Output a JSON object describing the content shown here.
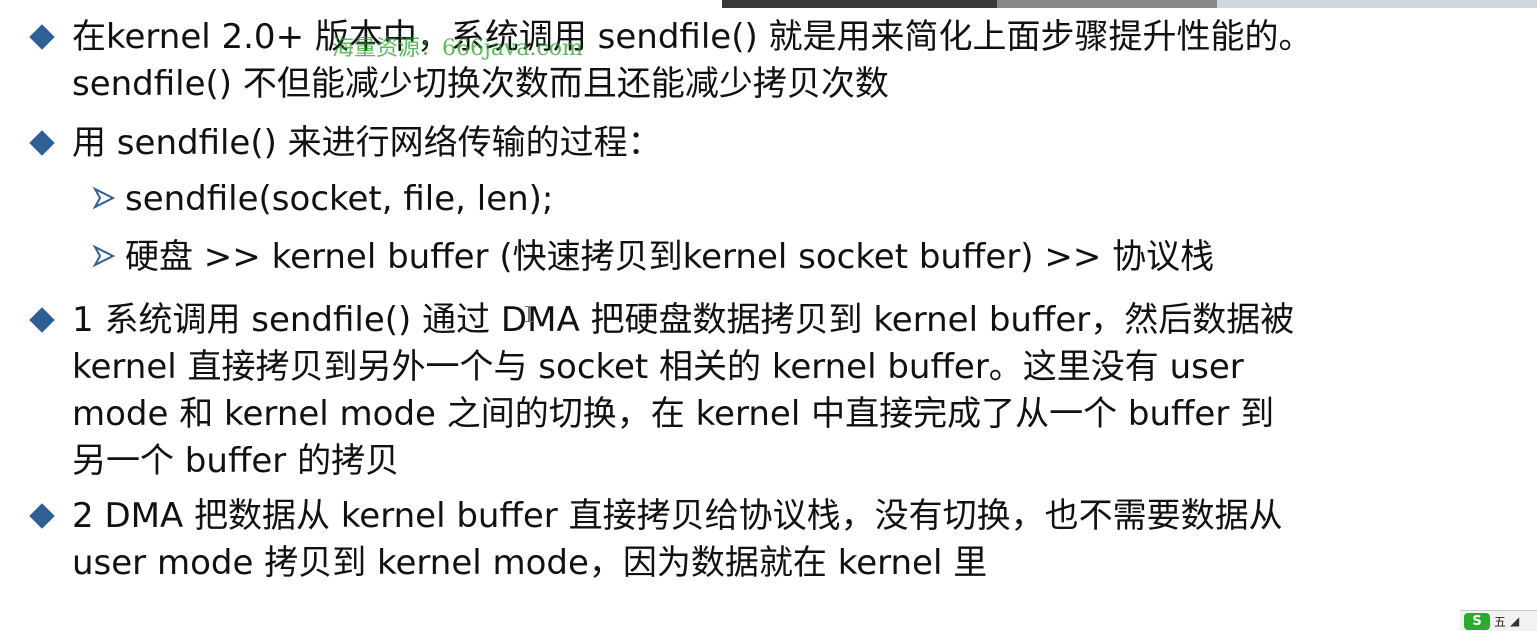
{
  "slide": {
    "bullet1": {
      "line1": "在kernel 2.0+ 版本中，系统调用 sendfile() 就是用来简化上面步骤提升性能的。",
      "line2": "sendfile() 不但能减少切换次数而且还能减少拷贝次数"
    },
    "bullet2": {
      "text": "用 sendfile() 来进行网络传输的过程：",
      "sub1": "sendfile(socket, file, len);",
      "sub2": "硬盘 >> kernel buffer (快速拷贝到kernel socket buffer) >> 协议栈"
    },
    "bullet3": {
      "line1": "1 系统调用 sendfile() 通过 DMA 把硬盘数据拷贝到 kernel buffer，然后数据被",
      "line2": "kernel 直接拷贝到另外一个与 socket 相关的 kernel buffer。这里没有 user",
      "line3": "mode 和 kernel mode 之间的切换，在 kernel 中直接完成了从一个 buffer 到",
      "line4": "另一个 buffer 的拷贝"
    },
    "bullet4": {
      "line1": "2 DMA 把数据从 kernel buffer 直接拷贝给协议栈，没有切换，也不需要数据从",
      "line2": "user mode 拷贝到 kernel mode，因为数据就在 kernel 里"
    }
  },
  "watermark": "海量资源：666java.com",
  "tray": {
    "logo": "S",
    "text": "五"
  },
  "colors": {
    "bullet": "#2e5f95",
    "text": "#111111",
    "watermark": "#28a028"
  }
}
